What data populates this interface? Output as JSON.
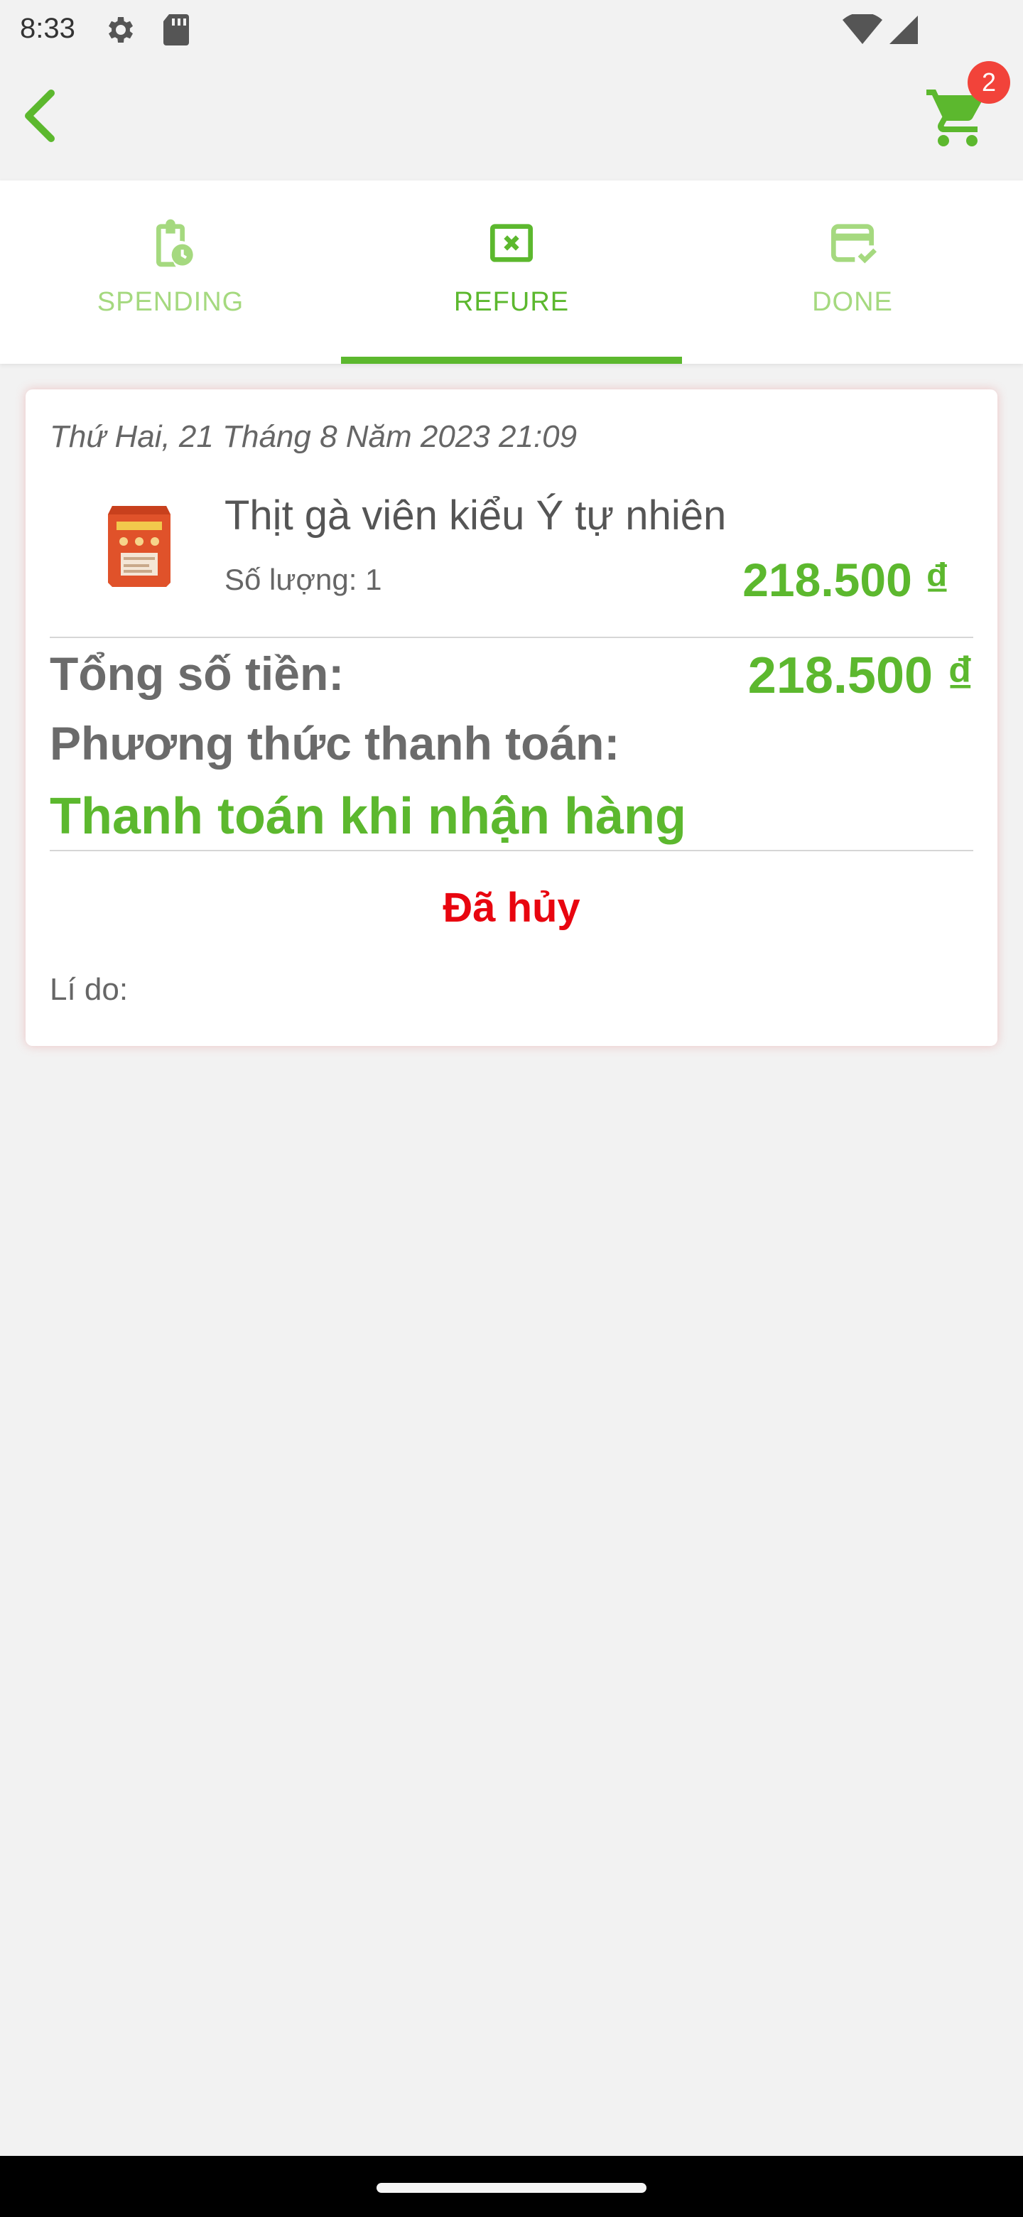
{
  "status_bar": {
    "time": "8:33"
  },
  "app_bar": {
    "cart_count": "2"
  },
  "tabs": [
    {
      "label": "SPENDING",
      "icon": "clipboard-clock-icon",
      "active": false
    },
    {
      "label": "REFURE",
      "icon": "x-box-icon",
      "active": true
    },
    {
      "label": "DONE",
      "icon": "card-check-icon",
      "active": false
    }
  ],
  "order": {
    "date": "Thứ Hai, 21 Tháng 8 Năm 2023 21:09",
    "item": {
      "name": "Thịt gà viên kiểu Ý tự nhiên",
      "quantity": "Số lượng: 1",
      "price": "218.500 ₫"
    },
    "total_label": "Tổng số tiền:",
    "total_value": "218.500 ₫",
    "payment_label": "Phương thức thanh toán:",
    "payment_value": "Thanh toán khi nhận hàng",
    "status": "Đã hủy",
    "reason_label": "Lí do:"
  },
  "colors": {
    "accent_green": "#5cb82e",
    "inactive_green": "#a5d97f",
    "cancel_red": "#e8050f",
    "badge_red": "#f2433a"
  }
}
